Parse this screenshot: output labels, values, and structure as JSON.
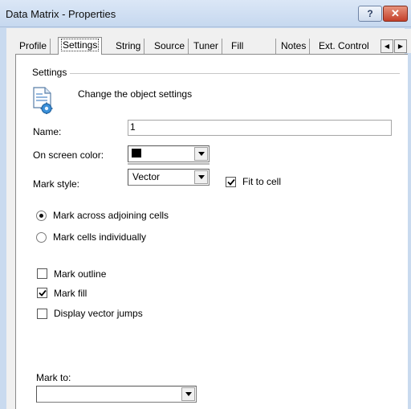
{
  "window": {
    "title": "Data Matrix - Properties",
    "help_glyph": "?",
    "close_glyph": "✕"
  },
  "tabs": [
    {
      "label": "Profile"
    },
    {
      "label": "Settings",
      "active": true
    },
    {
      "label": "String"
    },
    {
      "label": "Source"
    },
    {
      "label": "Tuner"
    },
    {
      "label": "Fill"
    },
    {
      "label": "Notes"
    },
    {
      "label": "Ext. Control"
    }
  ],
  "tab_scroll": {
    "left": "◀",
    "right": "▶"
  },
  "settings": {
    "group_title": "Settings",
    "icon": "settings-document-icon",
    "description": "Change the object settings",
    "name_label": "Name:",
    "name_value": "1",
    "color_label": "On screen color:",
    "color_value": "#000000",
    "mark_style_label": "Mark style:",
    "mark_style_value": "Vector",
    "fit_to_cell_label": "Fit to cell",
    "fit_to_cell_checked": true,
    "radio_across_label": "Mark across adjoining cells",
    "radio_across_selected": true,
    "radio_individually_label": "Mark cells individually",
    "radio_individually_selected": false,
    "mark_outline_label": "Mark outline",
    "mark_outline_checked": false,
    "mark_fill_label": "Mark fill",
    "mark_fill_checked": true,
    "vector_jumps_label": "Display vector jumps",
    "vector_jumps_checked": false,
    "mark_to_label": "Mark to:",
    "mark_to_value": ""
  }
}
